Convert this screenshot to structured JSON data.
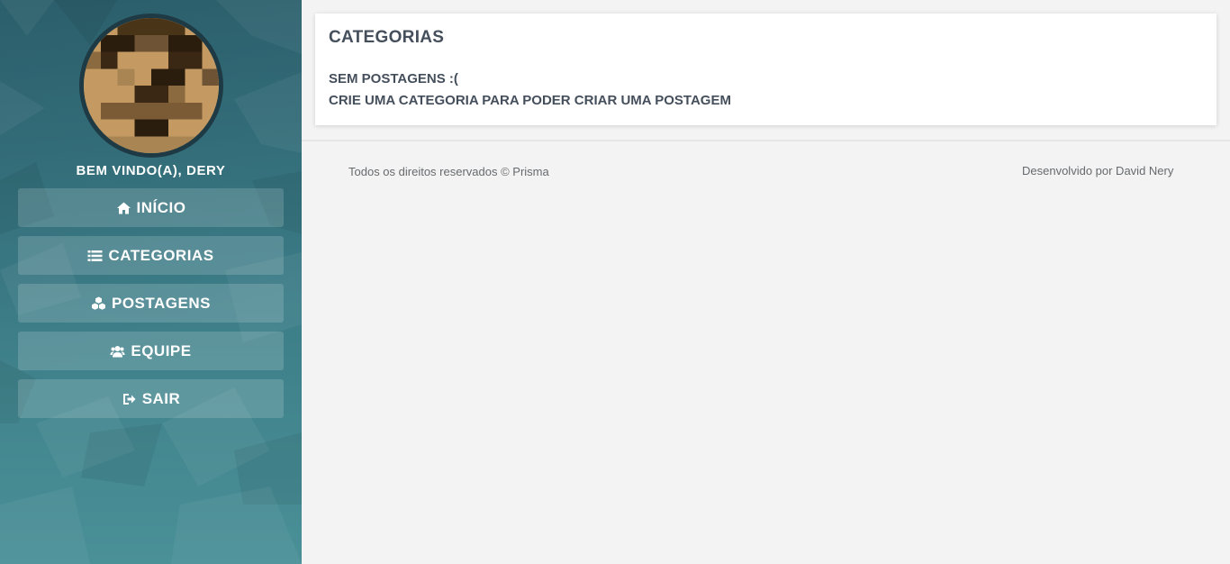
{
  "sidebar": {
    "welcome": "BEM VINDO(A), DERY",
    "items": [
      {
        "label": "INÍCIO",
        "icon": "home-icon"
      },
      {
        "label": "CATEGORIAS",
        "icon": "list-icon"
      },
      {
        "label": "POSTAGENS",
        "icon": "cubes-icon"
      },
      {
        "label": "EQUIPE",
        "icon": "users-icon"
      },
      {
        "label": "SAIR",
        "icon": "sign-out-icon"
      }
    ]
  },
  "main": {
    "title": "CATEGORIAS",
    "message_line1": "SEM POSTAGENS :(",
    "message_line2": "CRIE UMA CATEGORIA PARA PODER CRIAR UMA POSTAGEM"
  },
  "footer": {
    "left": "Todos os direitos reservados © Prisma",
    "right": "Desenvolvido por David Nery"
  },
  "colors": {
    "sidebar": "#3a7a85",
    "avatar_border": "#1e3a45",
    "text": "#454f5c",
    "background": "#f3f3f4"
  }
}
